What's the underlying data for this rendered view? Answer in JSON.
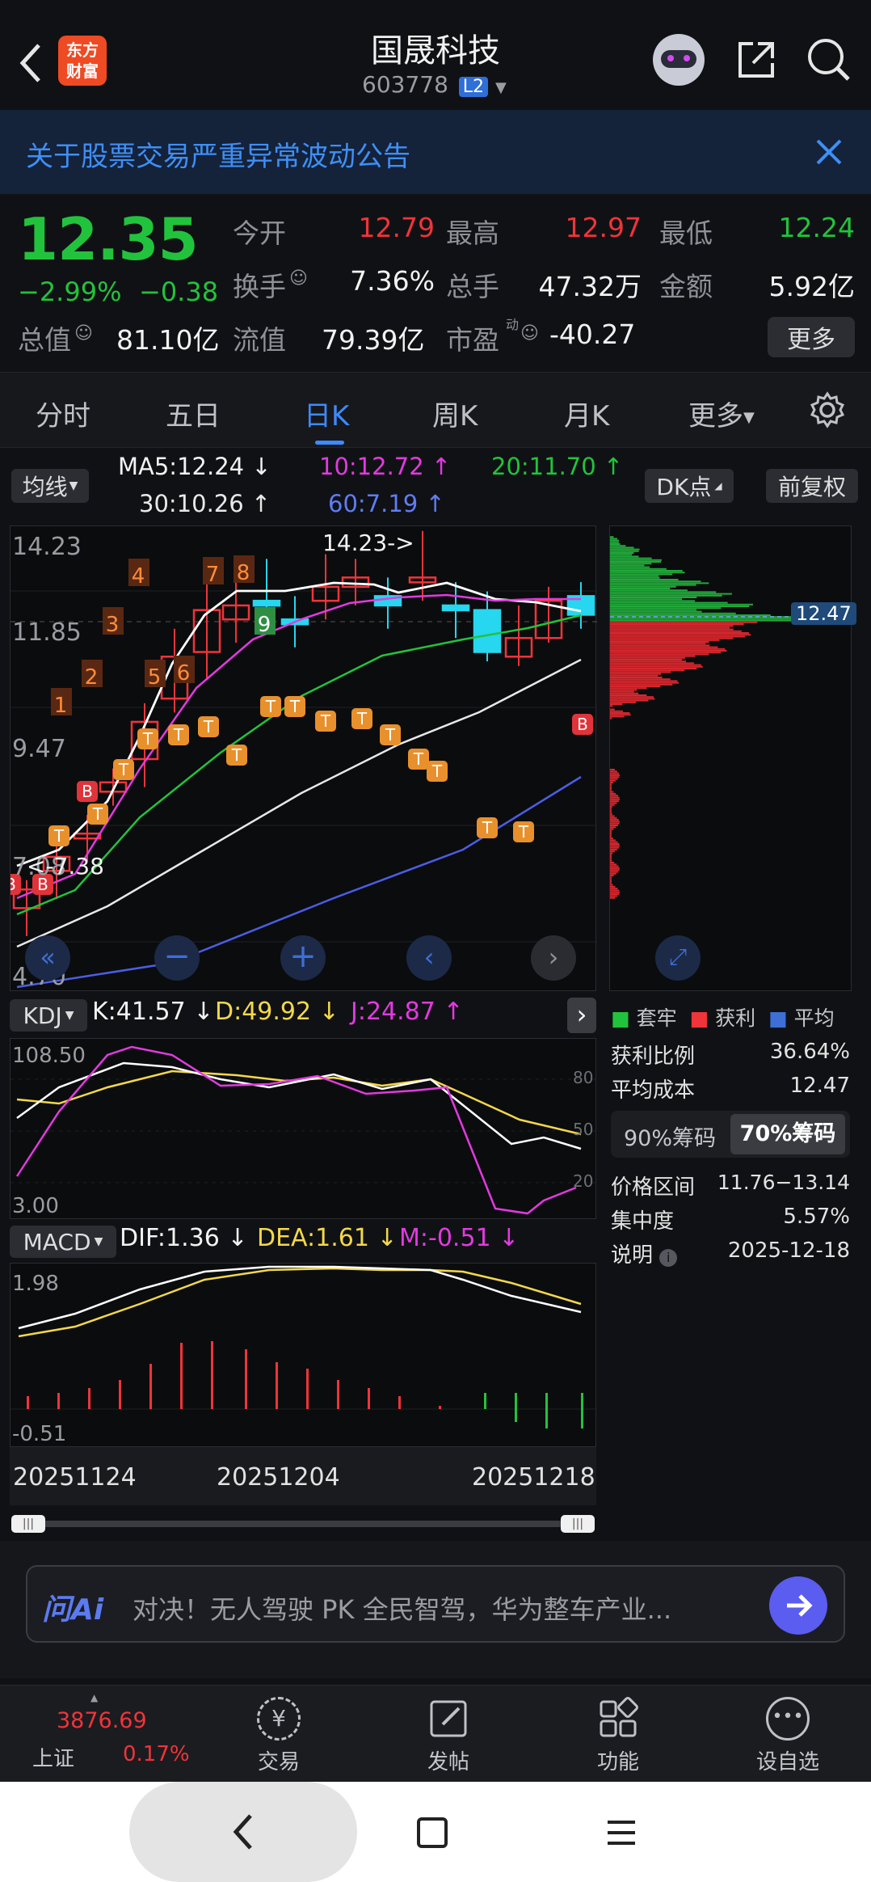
{
  "header": {
    "title": "国晟科技",
    "code": "603778",
    "level": "L2",
    "logo_line1": "东方",
    "logo_line2": "财富"
  },
  "notice": {
    "text": "关于股票交易严重异常波动公告"
  },
  "quote": {
    "price": "12.35",
    "pct": "−2.99%",
    "chg": "−0.38",
    "rows": [
      [
        {
          "label": "今开",
          "value": "12.79",
          "color": "red"
        },
        {
          "label": "最高",
          "value": "12.97",
          "color": "red"
        },
        {
          "label": "最低",
          "value": "12.24",
          "color": "green"
        }
      ],
      [
        {
          "label": "换手",
          "value": "7.36%",
          "color": "white"
        },
        {
          "label": "总手",
          "value": "47.32万",
          "color": "white"
        },
        {
          "label": "金额",
          "value": "5.92亿",
          "color": "white"
        }
      ]
    ],
    "mcap_label": "总值",
    "mcap": "81.10亿",
    "float_label": "流值",
    "float": "79.39亿",
    "pe_label": "市盈",
    "pe_sup": "动",
    "pe": "-40.27",
    "more": "更多"
  },
  "tabs": [
    "分时",
    "五日",
    "日K",
    "周K",
    "月K",
    "更多"
  ],
  "active_tab": 2,
  "ma": {
    "selector": "均线",
    "ma5": "MA5:12.24",
    "ma10": "10:12.72",
    "ma20": "20:11.70",
    "ma30": "30:10.26",
    "ma60": "60:7.19",
    "arrow_down": "↓",
    "arrow_up": "↑"
  },
  "buttons": {
    "dk": "DK点",
    "adjust": "前复权"
  },
  "kline": {
    "y_top": "14.23",
    "y_2": "11.85",
    "y_3": "9.47",
    "y_4": "7.08",
    "y_bottom": "4.70",
    "high_note": "14.23->",
    "low_note": "<-7.38",
    "chip_price": "12.47"
  },
  "countdown": [
    "1",
    "2",
    "3",
    "4",
    "5",
    "6",
    "7",
    "8",
    "9"
  ],
  "kdj": {
    "label": "KDJ",
    "k": "K:41.57",
    "d": "D:49.92",
    "j": "J:24.87",
    "y_top": "108.50",
    "y_bottom": "3.00",
    "levels": [
      "80",
      "50",
      "20"
    ]
  },
  "macd": {
    "label": "MACD",
    "dif": "DIF:1.36",
    "dea": "DEA:1.61",
    "m": "M:-0.51",
    "y_top": "1.98",
    "y_bottom": "-0.51"
  },
  "dates": [
    "20251124",
    "20251204",
    "20251218"
  ],
  "chips": {
    "legend": [
      "套牢",
      "获利",
      "平均"
    ],
    "profit_ratio_label": "获利比例",
    "profit_ratio": "36.64%",
    "avg_cost_label": "平均成本",
    "avg_cost": "12.47",
    "tab90": "90%筹码",
    "tab70": "70%筹码",
    "range_label": "价格区间",
    "range": "11.76−13.14",
    "concentration_label": "集中度",
    "concentration": "5.57%",
    "note_label": "说明",
    "note_date": "2025-12-18"
  },
  "ai": {
    "logo": "问Ai",
    "text": "对决！无人驾驶 PK 全民智驾，华为整车产业..."
  },
  "bottom": {
    "index_value": "3876.69",
    "index_name": "上证",
    "index_pct": "0.17%",
    "items": [
      "交易",
      "发帖",
      "功能",
      "设自选"
    ]
  },
  "colors": {
    "up": "#f0343a",
    "down": "#22c33c",
    "accent": "#3d8bff",
    "ai_blue": "#5b5cf0"
  }
}
